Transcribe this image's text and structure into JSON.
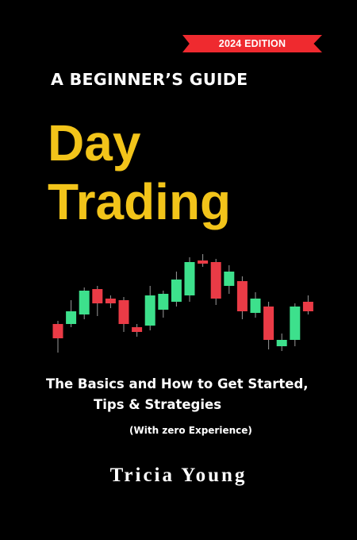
{
  "cover": {
    "edition": "2024 EDITION",
    "subtitle_top": "A BEGINNER’S GUIDE",
    "title_line1": "Day",
    "title_line2": "Trading",
    "tagline_line1": "The Basics and How to Get Started,",
    "tagline_line2": "Tips & Strategies",
    "tagline_line3": "(With zero Experience)",
    "author": "Tricia Young"
  },
  "colors": {
    "background": "#000000",
    "title": "#f2c41a",
    "ribbon": "#ef2a2f",
    "bullish": "#3de08c",
    "bearish": "#ea3b46",
    "wick": "#9a9a9a"
  },
  "candles": [
    {
      "dir": "down",
      "open": 62,
      "close": 44,
      "high": 66,
      "low": 26
    },
    {
      "dir": "up",
      "open": 62,
      "close": 78,
      "high": 92,
      "low": 58
    },
    {
      "dir": "up",
      "open": 74,
      "close": 104,
      "high": 108,
      "low": 68
    },
    {
      "dir": "down",
      "open": 106,
      "close": 88,
      "high": 110,
      "low": 72
    },
    {
      "dir": "down",
      "open": 94,
      "close": 88,
      "high": 98,
      "low": 82
    },
    {
      "dir": "down",
      "open": 92,
      "close": 62,
      "high": 96,
      "low": 52
    },
    {
      "dir": "down",
      "open": 58,
      "close": 52,
      "high": 62,
      "low": 46
    },
    {
      "dir": "up",
      "open": 60,
      "close": 98,
      "high": 110,
      "low": 54
    },
    {
      "dir": "up",
      "open": 80,
      "close": 100,
      "high": 104,
      "low": 70
    },
    {
      "dir": "up",
      "open": 90,
      "close": 118,
      "high": 128,
      "low": 84
    },
    {
      "dir": "up",
      "open": 98,
      "close": 140,
      "high": 146,
      "low": 90
    },
    {
      "dir": "down",
      "open": 142,
      "close": 138,
      "high": 150,
      "low": 134
    },
    {
      "dir": "down",
      "open": 140,
      "close": 94,
      "high": 144,
      "low": 86
    },
    {
      "dir": "up",
      "open": 110,
      "close": 128,
      "high": 136,
      "low": 100
    },
    {
      "dir": "down",
      "open": 116,
      "close": 78,
      "high": 122,
      "low": 68
    },
    {
      "dir": "up",
      "open": 76,
      "close": 94,
      "high": 102,
      "low": 70
    },
    {
      "dir": "down",
      "open": 84,
      "close": 42,
      "high": 90,
      "low": 30
    },
    {
      "dir": "up",
      "open": 34,
      "close": 42,
      "high": 50,
      "low": 28
    },
    {
      "dir": "up",
      "open": 42,
      "close": 84,
      "high": 88,
      "low": 34
    },
    {
      "dir": "down",
      "open": 90,
      "close": 78,
      "high": 98,
      "low": 74
    }
  ]
}
